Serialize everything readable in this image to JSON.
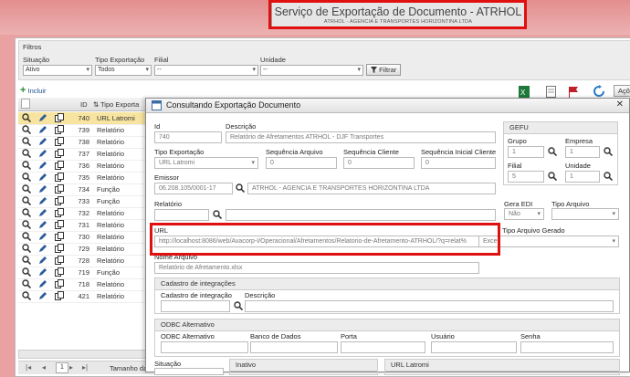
{
  "header": {
    "title": "Serviço de Exportação de Documento - ATRHOL",
    "subtitle": "ATRHOL - AGENCIA E TRANSPORTES HORIZONTINA LTDA"
  },
  "filters": {
    "title": "Filtros",
    "situacao": {
      "label": "Situação",
      "value": "Ativo"
    },
    "tipo": {
      "label": "Tipo Exportação",
      "value": "Todos"
    },
    "filial": {
      "label": "Filial",
      "value": "--"
    },
    "unidade": {
      "label": "Unidade",
      "value": "--"
    },
    "button": "Filtrar"
  },
  "toolbar": {
    "incluir": "Incluir",
    "acoes": "Açõ"
  },
  "grid": {
    "col_id": "ID",
    "col_tipo": "Tipo Exporta",
    "rows": [
      {
        "id": "740",
        "tipo": "URL Latromi"
      },
      {
        "id": "739",
        "tipo": "Relatório"
      },
      {
        "id": "738",
        "tipo": "Relatório"
      },
      {
        "id": "737",
        "tipo": "Relatório"
      },
      {
        "id": "736",
        "tipo": "Relatório"
      },
      {
        "id": "735",
        "tipo": "Relatório"
      },
      {
        "id": "734",
        "tipo": "Função"
      },
      {
        "id": "733",
        "tipo": "Função"
      },
      {
        "id": "732",
        "tipo": "Relatório"
      },
      {
        "id": "731",
        "tipo": "Relatório"
      },
      {
        "id": "730",
        "tipo": "Relatório"
      },
      {
        "id": "729",
        "tipo": "Relatório"
      },
      {
        "id": "728",
        "tipo": "Relatório"
      },
      {
        "id": "719",
        "tipo": "Função"
      },
      {
        "id": "718",
        "tipo": "Relatório"
      },
      {
        "id": "421",
        "tipo": "Relatório"
      }
    ],
    "pager": {
      "page": "1",
      "size_label": "Tamanho da"
    }
  },
  "modal": {
    "title": "Consultando Exportação Documento",
    "id": {
      "label": "Id",
      "value": "740"
    },
    "descricao": {
      "label": "Descrição",
      "value": "Relatório de Afretamentos ATRHOL - DJF Transportes"
    },
    "tipo_exportacao": {
      "label": "Tipo Exportação",
      "value": "URL Latromi"
    },
    "seq_arquivo": {
      "label": "Sequência Arquivo",
      "value": "0"
    },
    "seq_cliente": {
      "label": "Sequência Cliente",
      "value": "0"
    },
    "seq_inicial_cliente": {
      "label": "Sequência Inicial Cliente",
      "value": "0"
    },
    "emissor": {
      "label": "Emissor",
      "cnpj": "06.208.105/0001-17",
      "name": "ATRHOL - AGENCIA E TRANSPORTES HORIZONTINA LTDA"
    },
    "relatorio": {
      "label": "Relatório",
      "value": ""
    },
    "gera_edi": {
      "label": "Gera EDI",
      "value": "Não"
    },
    "tipo_arquivo": {
      "label": "Tipo Arquivo",
      "value": ""
    },
    "url": {
      "label": "URL",
      "value": "http://localhost:8086/web/Avacorp-I/Operacional/Afretamentos/Relatorio-de-Afretamento-ATRHOL/?q=relat%"
    },
    "tipo_arquivo_gerado": {
      "label": "Tipo Arquivo Gerado",
      "value": "Excel"
    },
    "nome_arquivo": {
      "label": "Nome Arquivo",
      "value": "Relatório de Afretamento.xlsx"
    },
    "gefu": {
      "title": "GEFU",
      "grupo": {
        "label": "Grupo",
        "value": "1"
      },
      "empresa": {
        "label": "Empresa",
        "value": "1"
      },
      "filial": {
        "label": "Filial",
        "value": "5"
      },
      "unidade": {
        "label": "Unidade",
        "value": "1"
      }
    },
    "cadastro": {
      "title": "Cadastro de integrações",
      "label": "Cadastro de integração",
      "desc": "Descrição"
    },
    "odbc": {
      "title": "ODBC Alternativo",
      "alt": "ODBC Alternativo",
      "banco": "Banco de Dados",
      "porta": "Porta",
      "usuario": "Usuário",
      "senha": "Senha"
    },
    "situacao": {
      "label": "Situação"
    },
    "inativo": "Inativo",
    "url_latromi": "URL Latromi"
  }
}
